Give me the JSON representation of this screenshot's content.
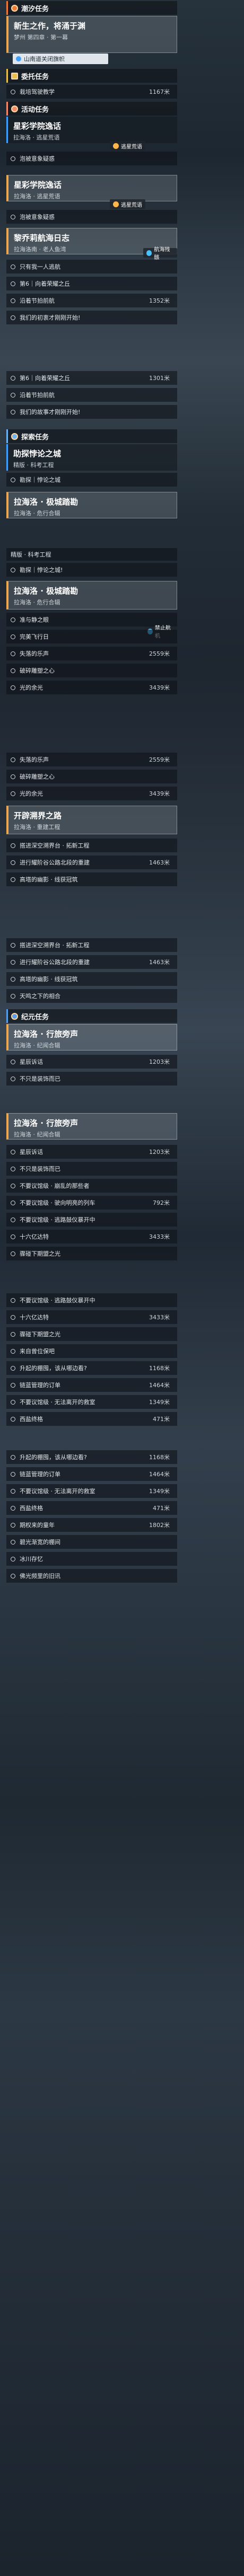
{
  "sections": {
    "story": "潮汐任务",
    "commission": "委托任务",
    "activity": "活动任务",
    "explore": "探索任务",
    "jc": "纪元任务"
  },
  "quests": {
    "q1": {
      "title": "新生之作，将涌于渊",
      "sub": "梦州 第四章 · 第一幕",
      "btn": "山南道关闭旗帜"
    },
    "q2": {
      "title": "星彩学院逸话",
      "sub": "拉海洛 · 逃星荒语"
    },
    "q3": {
      "title": "星彩学院逸话",
      "sub": "拉海洛 · 逃星荒语"
    },
    "q4": {
      "title": "黎乔莉航海日志",
      "sub": "拉海洛南 · 老人鱼湾"
    },
    "q5": {
      "title": "助探悖论之城",
      "sub": "精版 · 科考工程"
    },
    "q6": {
      "title": "拉海洛 · 极城踏勘",
      "sub": "拉海洛 · 危行合辑"
    },
    "q7": {
      "title": "拉海洛 · 极城踏勘",
      "sub": "拉海洛 · 危行合辑"
    },
    "q8": {
      "title": "开辟溯界之路",
      "sub": "拉海洛 · 重建工程"
    },
    "q9": {
      "title": "拉海洛 · 行旅旁声",
      "sub": "拉海洛 · 纪闻合辑"
    },
    "q10": {
      "title": "拉海洛 · 行旅旁声",
      "sub": "拉海洛 · 纪闻合辑"
    }
  },
  "tags": {
    "t1": "逃星荒语",
    "t2": "逃星荒语",
    "t3": "航海残骸",
    "t4": "禁止航机"
  },
  "objectives": [
    {
      "label": "栽培驾驶教学",
      "dist": "1167米"
    },
    {
      "label": "泡被意象疑惑",
      "dist": ""
    },
    {
      "label": "泡被意象疑惑",
      "dist": ""
    },
    {
      "label": "只有我一人逃航",
      "dist": ""
    },
    {
      "label": "第6｜向着荣耀之丘",
      "dist": ""
    },
    {
      "label": "沿着节拍前航",
      "dist": "1352米"
    },
    {
      "label": "我们的初衷才刚刚开始!",
      "dist": ""
    },
    {
      "label": "第6｜向着荣耀之丘",
      "dist": "1301米"
    },
    {
      "label": "沿着节拍前航",
      "dist": ""
    },
    {
      "label": "我们的故事才刚刚开始!",
      "dist": ""
    },
    {
      "label": "勘探｜悖论之城",
      "dist": ""
    },
    {
      "label": "勘探｜悖论之城!",
      "dist": ""
    },
    {
      "label": "准与静之眼",
      "dist": ""
    },
    {
      "label": "完美飞行日",
      "dist": ""
    },
    {
      "label": "失落的乐声",
      "dist": "2559米"
    },
    {
      "label": "破碎雕塑之心",
      "dist": ""
    },
    {
      "label": "光的余光",
      "dist": "3439米"
    },
    {
      "label": "失落的乐声",
      "dist": "2559米"
    },
    {
      "label": "破碎雕塑之心",
      "dist": ""
    },
    {
      "label": "光的余光",
      "dist": "3439米"
    },
    {
      "label": "搭进深空溯界台 · 拓新工程",
      "dist": ""
    },
    {
      "label": "进行耀阶谷公路北段的重建",
      "dist": "1463米"
    },
    {
      "label": "高塔的幽影 · 线获冠筑",
      "dist": ""
    },
    {
      "label": "搭进深空溯界台 · 拓新工程",
      "dist": ""
    },
    {
      "label": "进行耀阶谷公路北段的重建",
      "dist": "1463米"
    },
    {
      "label": "高塔的幽影 · 线获冠筑",
      "dist": ""
    },
    {
      "label": "天鸣之下的相合",
      "dist": ""
    },
    {
      "label": "星辰诉话",
      "dist": "1203米"
    },
    {
      "label": "不只是装饰而已",
      "dist": ""
    },
    {
      "label": "星辰诉话",
      "dist": "1203米"
    },
    {
      "label": "不只是装饰而已",
      "dist": ""
    },
    {
      "label": "不要议馆级 · 崩乱的那些者",
      "dist": ""
    },
    {
      "label": "不要议馆级 · 驶向明亮的列车",
      "dist": "792米"
    },
    {
      "label": "不要议馆级 · 逃路鼓仪暴开中",
      "dist": ""
    },
    {
      "label": "十六亿达特",
      "dist": "3433米"
    },
    {
      "label": "骤碰下期盟之光",
      "dist": ""
    },
    {
      "label": "不要议馆级 · 逃路鼓仪暴开中",
      "dist": ""
    },
    {
      "label": "十六亿达特",
      "dist": "3433米"
    },
    {
      "label": "骤碰下期盟之光",
      "dist": ""
    },
    {
      "label": "来自曾位保吧",
      "dist": ""
    },
    {
      "label": "升起的棚囤，该从哪边看?",
      "dist": "1168米"
    },
    {
      "label": "链蓝管理的订单",
      "dist": "1464米"
    },
    {
      "label": "不要议馆级 · 无法离开的救室",
      "dist": "1349米"
    },
    {
      "label": "西盐终格",
      "dist": "471米"
    },
    {
      "label": "升起的棚囤，该从哪边看?",
      "dist": "1168米"
    },
    {
      "label": "链蓝管理的订单",
      "dist": "1464米"
    },
    {
      "label": "不要议馆级 · 无法离开的救室",
      "dist": "1349米"
    },
    {
      "label": "西盐终格",
      "dist": "471米"
    },
    {
      "label": "期权来的童年",
      "dist": "1802米"
    },
    {
      "label": "碧光渐宽的棚间",
      "dist": ""
    },
    {
      "label": "冰川存忆",
      "dist": ""
    },
    {
      "label": "佛光频里的旧讯",
      "dist": ""
    }
  ]
}
